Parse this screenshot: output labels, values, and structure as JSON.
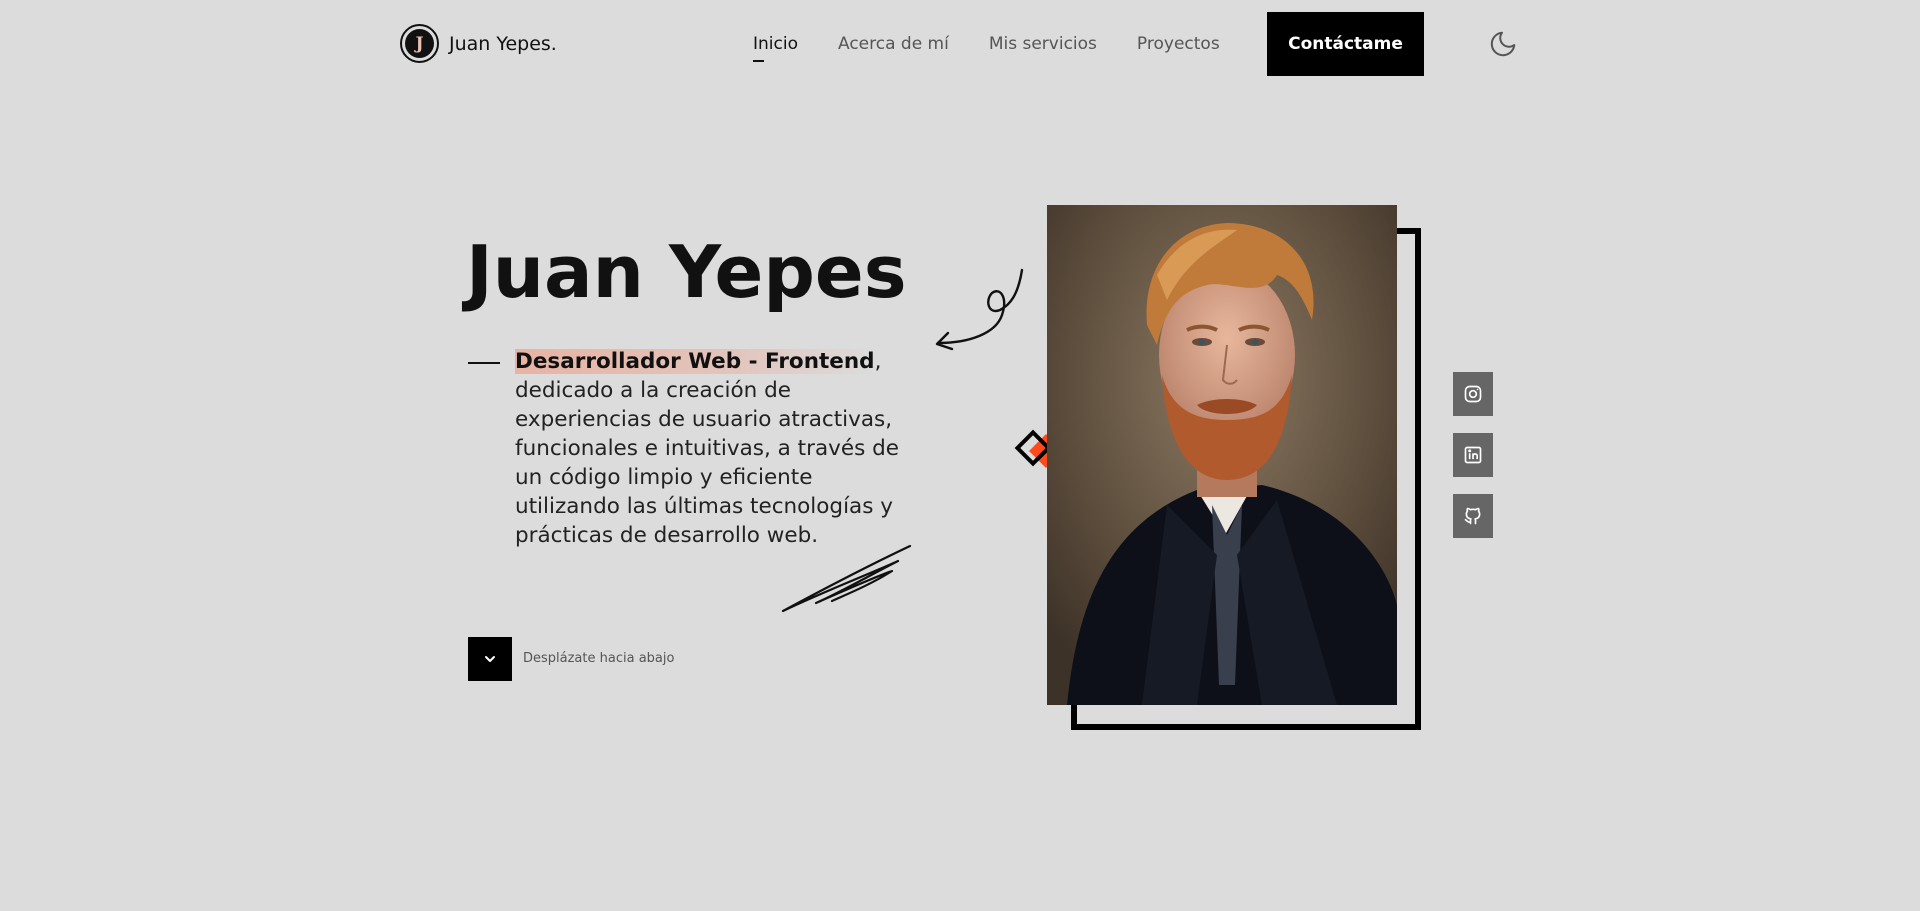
{
  "header": {
    "brand_initial": "J",
    "brand_name": "Juan Yepes.",
    "nav": [
      {
        "label": "Inicio",
        "active": true
      },
      {
        "label": "Acerca de mí",
        "active": false
      },
      {
        "label": "Mis servicios",
        "active": false
      },
      {
        "label": "Proyectos",
        "active": false
      }
    ],
    "contact_label": "Contáctame",
    "theme_icon": "moon-icon"
  },
  "hero": {
    "title": "Juan Yepes",
    "role": "Desarrollador Web - Frontend",
    "description": ", dedicado a la creación de experiencias de usuario atractivas, funcionales e intuitivas, a través de un código limpio y eficiente utilizando las últimas tecnologías y prácticas de desarrollo web.",
    "scroll_label": "Desplázate hacia abajo",
    "scroll_icon": "chevron-down-icon"
  },
  "social": [
    {
      "name": "instagram-icon"
    },
    {
      "name": "linkedin-icon"
    },
    {
      "name": "github-icon"
    }
  ],
  "colors": {
    "background": "#dcdcdc",
    "accent": "#ff4a1c",
    "highlight": "#e8b3a3",
    "social_bg": "#666666"
  }
}
